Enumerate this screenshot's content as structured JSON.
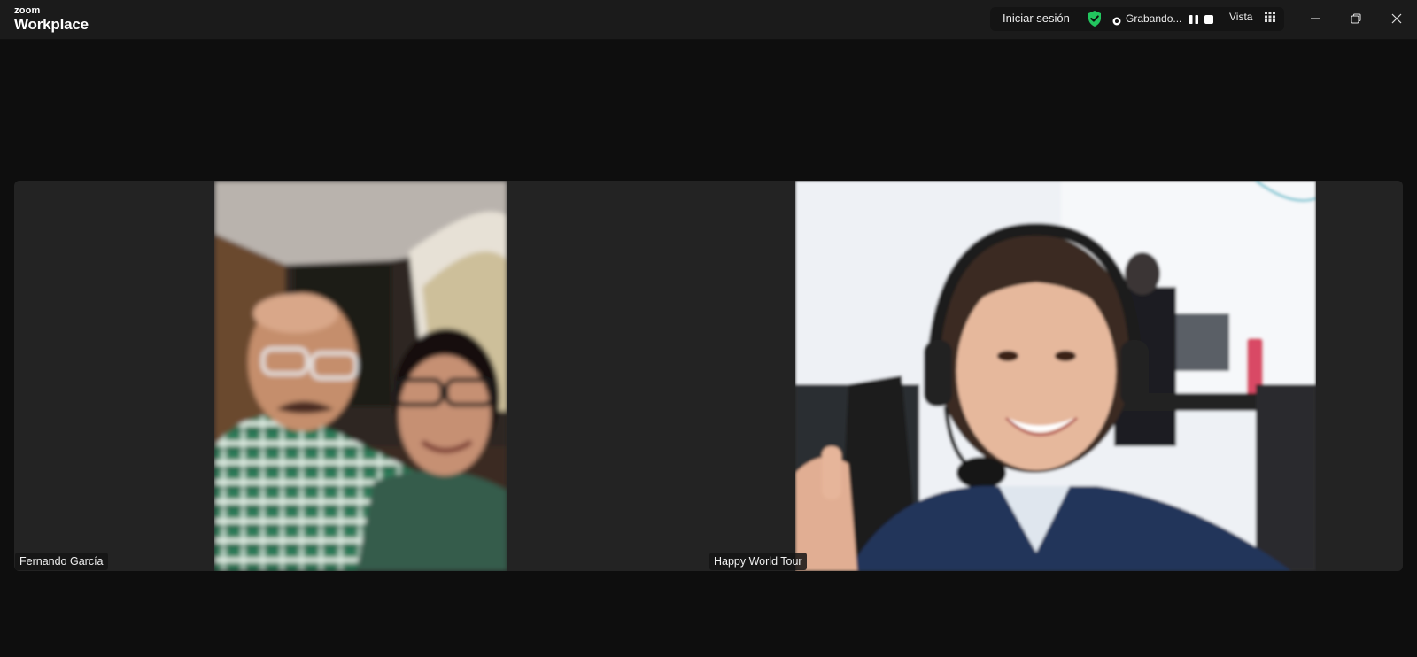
{
  "app": {
    "brand_top": "zoom",
    "brand_bottom": "Workplace"
  },
  "toolbar": {
    "signin_label": "Iniciar sesión",
    "recording_label": "Grabando...",
    "view_label": "Vista",
    "icons": [
      "shield-check-icon",
      "recording-dot-icon",
      "pause-icon",
      "stop-icon",
      "grid-icon"
    ],
    "accent_color": "#22c55e"
  },
  "window_controls": {
    "icons": [
      "minimize-icon",
      "restore-icon",
      "close-icon"
    ]
  },
  "participants": [
    {
      "name": "Fernando García"
    },
    {
      "name": "Happy World Tour"
    }
  ]
}
